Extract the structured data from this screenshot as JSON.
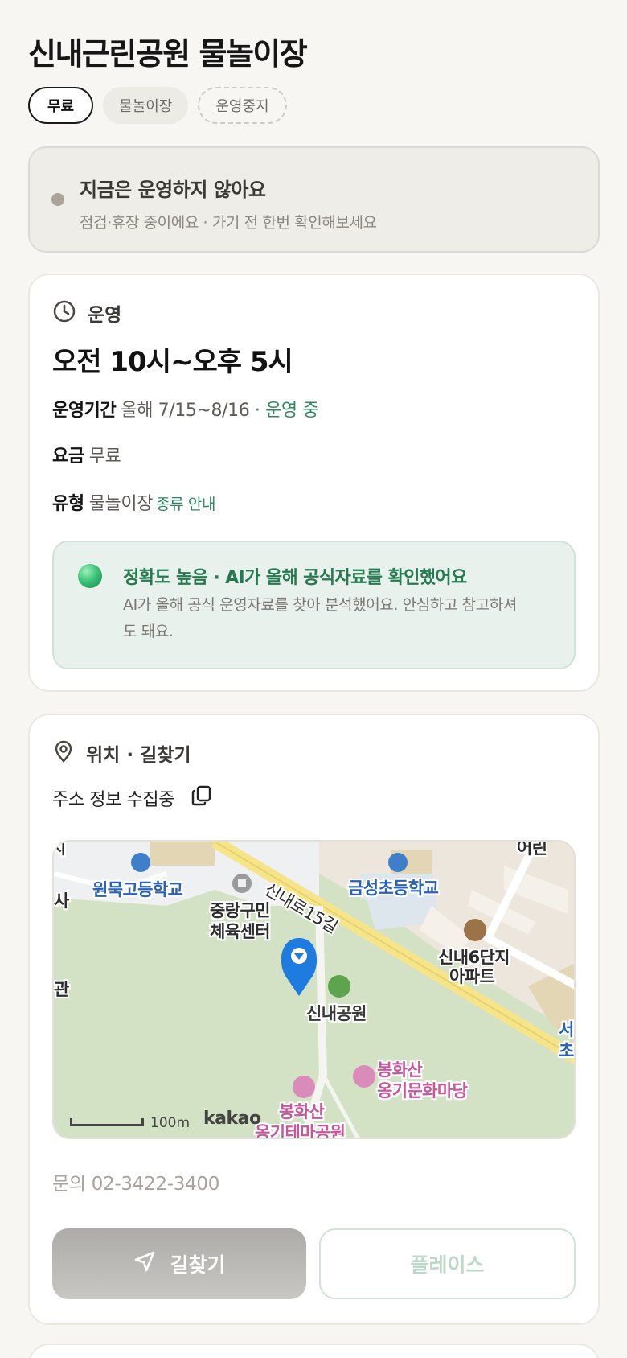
{
  "page": {
    "title": "신내근린공원 물놀이장"
  },
  "chips": {
    "price": "무료",
    "type": "물놀이장",
    "status": "운영중지"
  },
  "notice": {
    "title": "지금은 운영하지 않아요",
    "subtitle": "점검·휴장 중이에요 · 가기 전 한번 확인해보세요"
  },
  "operation": {
    "section_label": "운영",
    "icon": "clock-icon",
    "hours": "오전 10시~오후 5시",
    "period_label": "운영기간",
    "period_value": "올해 7/15~8/16",
    "period_status": "· 운영 중",
    "fee_label": "요금",
    "fee_value": "무료",
    "type_label": "유형",
    "type_value": "물놀이장",
    "type_link": "종류 안내"
  },
  "ai_notice": {
    "title": "정확도 높음 · AI가 올해 공식자료를 확인했어요",
    "description": "AI가 올해 공식 운영자료를 찾아 분석했어요. 안심하고 참고하셔도 돼요."
  },
  "location": {
    "section_label": "위치 · 길찾기",
    "icon": "map-pin-icon",
    "address": "주소 정보 수집중",
    "copy_icon": "copy-icon"
  },
  "map": {
    "labels": {
      "school1": "원묵고등학교",
      "school2": "금성초등학교",
      "sports_center_1": "중랑구민",
      "sports_center_2": "체육센터",
      "road": "신내로15길",
      "apartment_1": "신내6단지",
      "apartment_2": "아파트",
      "park": "신내공원",
      "culture_1": "봉화산",
      "culture_2": "옹기문화마당",
      "theme_1": "봉화산",
      "theme_2": "옹기테마공원",
      "edge_left_1": "사",
      "edge_left_2": "관",
      "edge_top_left": "지",
      "edge_top_right": "어린",
      "edge_right_1": "서",
      "edge_right_2": "초"
    },
    "scale": "100m",
    "brand": "kakao"
  },
  "contact": {
    "text": "문의 02-3422-3400"
  },
  "buttons": {
    "route": "길찾기",
    "place": "플레이스"
  },
  "colors": {
    "accent_green": "#2c8a5c",
    "map_pin": "#1e7be0"
  }
}
